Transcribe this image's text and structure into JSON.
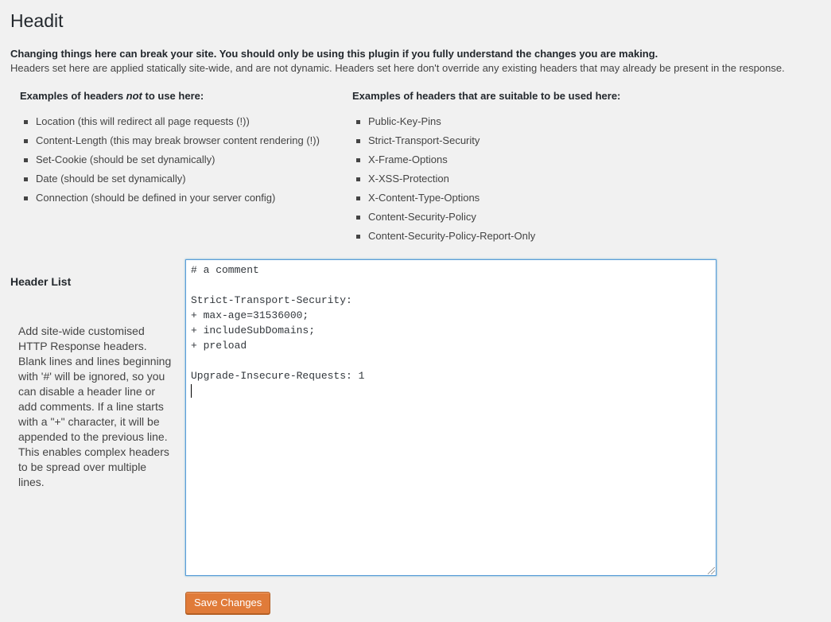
{
  "page": {
    "title": "Headit",
    "warning": "Changing things here can break your site. You should only be using this plugin if you fully understand the changes you are making.",
    "note": "Headers set here are applied statically site-wide, and are not dynamic. Headers set here don't override any existing headers that may already be present in the response."
  },
  "examples_not": {
    "heading_before": "Examples of headers ",
    "heading_emphasis": "not",
    "heading_after": " to use here:",
    "items": [
      "Location (this will redirect all page requests (!))",
      "Content-Length (this may break browser content rendering (!))",
      "Set-Cookie (should be set dynamically)",
      "Date (should be set dynamically)",
      "Connection (should be defined in your server config)"
    ]
  },
  "examples_ok": {
    "heading": "Examples of headers that are suitable to be used here:",
    "items": [
      "Public-Key-Pins",
      "Strict-Transport-Security",
      "X-Frame-Options",
      "X-XSS-Protection",
      "X-Content-Type-Options",
      "Content-Security-Policy",
      "Content-Security-Policy-Report-Only"
    ]
  },
  "header_list": {
    "label": "Header List",
    "description": "Add site-wide customised HTTP Response headers. Blank lines and lines beginning with '#' will be ignored, so you can disable a header line or add comments. If a line starts with a \"+\" character, it will be appended to the previous line. This enables complex headers to be spread over multiple lines.",
    "lines": [
      "# a comment",
      "",
      "Strict-Transport-Security:",
      "+ max-age=31536000;",
      "+ includeSubDomains;",
      "+ preload",
      "",
      "Upgrade-Insecure-Requests: 1"
    ]
  },
  "actions": {
    "save_label": "Save Changes"
  },
  "colors": {
    "accent": "#e07b39",
    "focus_border": "#5b9dd9",
    "background": "#f1f1f1"
  }
}
